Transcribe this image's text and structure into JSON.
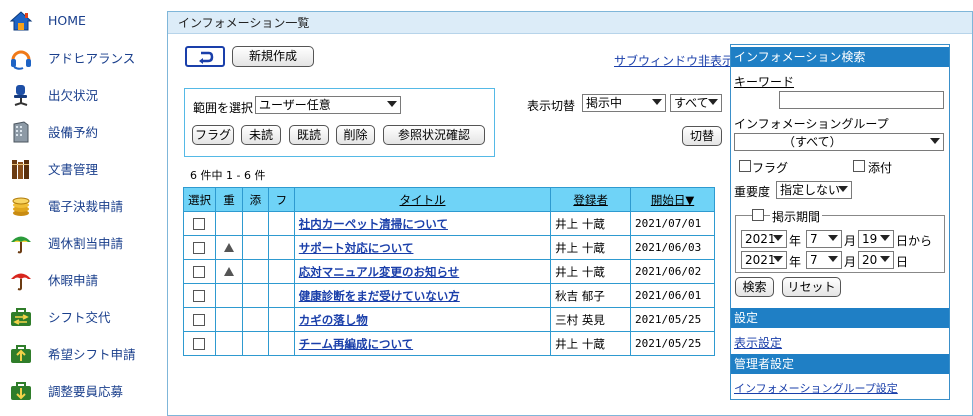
{
  "sidebar": {
    "items": [
      {
        "label": "HOME",
        "icon": "home-icon"
      },
      {
        "label": "アドヒアランス",
        "icon": "headset-icon"
      },
      {
        "label": "出欠状況",
        "icon": "chair-icon"
      },
      {
        "label": "設備予約",
        "icon": "building-icon"
      },
      {
        "label": "文書管理",
        "icon": "books-icon"
      },
      {
        "label": "電子決裁申請",
        "icon": "coins-icon"
      },
      {
        "label": "週休割当申請",
        "icon": "umbrella-green-icon"
      },
      {
        "label": "休暇申請",
        "icon": "umbrella-red-icon"
      },
      {
        "label": "シフト交代",
        "icon": "briefcase-swap-icon"
      },
      {
        "label": "希望シフト申請",
        "icon": "briefcase-up-icon"
      },
      {
        "label": "調整要員応募",
        "icon": "briefcase-down-icon"
      }
    ]
  },
  "main": {
    "title": "インフォメーション一覧",
    "new_button": "新規作成",
    "subwindow_link": "サブウィンドウ非表示",
    "range_label": "範囲を選択",
    "range_value": "ユーザー任意",
    "flag_button": "フラグ",
    "unread_button": "未読",
    "read_button": "既読",
    "delete_button": "削除",
    "ref_button": "参照状況確認",
    "display_switch_label": "表示切替",
    "display_value": "掲示中",
    "display_all": "すべて",
    "switch_button": "切替",
    "count_text": "6 件中 1 - 6 件"
  },
  "table": {
    "headers": {
      "select": "選択",
      "importance": "重",
      "attach": "添",
      "flag": "フ",
      "title": "タイトル",
      "registrant": "登録者",
      "start_date": "開始日▼"
    },
    "rows": [
      {
        "important": false,
        "title": "社内カーペット清掃について",
        "registrant": "井上 十蔵",
        "date": "2021/07/01"
      },
      {
        "important": true,
        "title": "サポート対応について",
        "registrant": "井上 十蔵",
        "date": "2021/06/03"
      },
      {
        "important": true,
        "title": "応対マニュアル変更のお知らせ",
        "registrant": "井上 十蔵",
        "date": "2021/06/02"
      },
      {
        "important": false,
        "title": "健康診断をまだ受けていない方",
        "registrant": "秋吉 郁子",
        "date": "2021/06/01"
      },
      {
        "important": false,
        "title": "カギの落し物",
        "registrant": "三村 英見",
        "date": "2021/05/25"
      },
      {
        "important": false,
        "title": "チーム再編成について",
        "registrant": "井上 十蔵",
        "date": "2021/05/25"
      }
    ]
  },
  "search": {
    "title": "インフォメーション検索",
    "keyword_label": "キーワード",
    "group_label": "インフォメーショングループ",
    "group_value": "（すべて）",
    "flag_label": "フラグ",
    "attach_label": "添付",
    "importance_label": "重要度",
    "importance_value": "指定しない",
    "period_label": "掲示期間",
    "from": {
      "year": "2021",
      "month": "7",
      "day": "19"
    },
    "to": {
      "year": "2021",
      "month": "7",
      "day": "20"
    },
    "year_suffix": "年",
    "month_suffix": "月",
    "day_from_suffix": "日から",
    "day_suffix": "日",
    "search_button": "検索",
    "reset_button": "リセット",
    "settings_bar": "設定",
    "display_settings_link": "表示設定",
    "admin_bar": "管理者設定",
    "group_settings_link": "インフォメーショングループ設定"
  },
  "colors": {
    "accent": "#1f7fc5",
    "header_cell": "#6fd3f7",
    "link": "#1a3faa"
  }
}
